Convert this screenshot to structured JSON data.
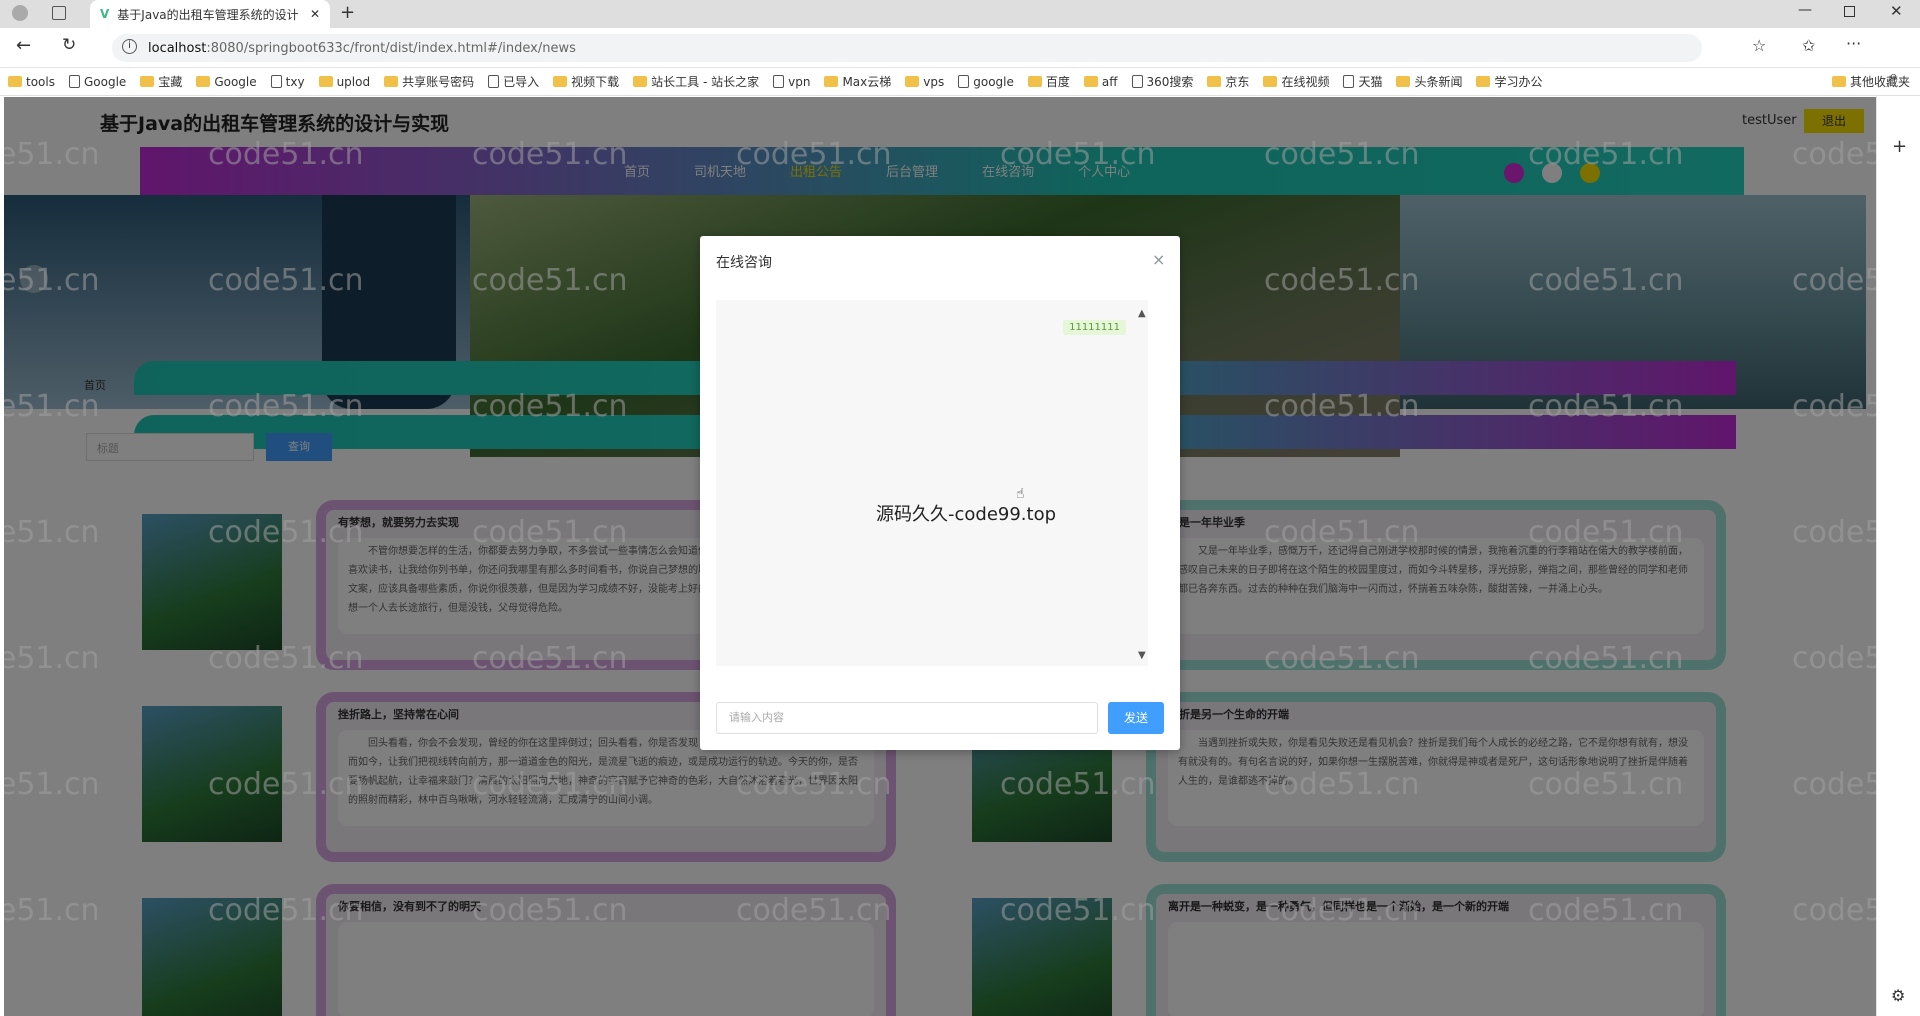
{
  "browser": {
    "tab_title": "基于Java的出租车管理系统的设计",
    "url_host": "localhost",
    "url_rest": ":8080/springboot633c/front/dist/index.html#/index/news",
    "bookmarks": [
      "tools",
      "Google",
      "宝藏",
      "Google",
      "txy",
      "uplod",
      "共享账号密码",
      "已导入",
      "视频下载",
      "站长工具 - 站长之家",
      "vpn",
      "Max云梯",
      "vps",
      "google",
      "百度",
      "aff",
      "360搜索",
      "京东",
      "在线视频",
      "天猫",
      "头条新闻",
      "学习办公"
    ],
    "other_bookmarks": "其他收藏夹"
  },
  "site": {
    "title": "基于Java的出租车管理系统的设计与实现",
    "user": "testUser",
    "logout": "退出",
    "nav": [
      "首页",
      "司机天地",
      "出租公告",
      "后台管理",
      "在线咨询",
      "个人中心"
    ],
    "breadcrumb_home": "首页",
    "search_placeholder": "标题",
    "search_button": "查询",
    "news": [
      {
        "title": "有梦想，就要努力去实现",
        "text": "不管你想要怎样的生活，你都要去努力争取，不多尝试一些事情怎么会知道你适合什么、不适合什么呢？你说你喜欢读书，让我给你列书单，你还问我哪里有那么多时间看书，你说自己梦想的职业是广告文案，问我如何成为一个文案，应该具备哪些素质，你说你很羡慕，但是因为学习成绩不好，没能考上好的学校……起不了床，你说你一直梦想一个人去长途旅行，但是没钱，父母觉得危险。"
      },
      {
        "title": "又是一年毕业季",
        "text": "又是一年毕业季，感慨万千，还记得自己刚进学校那时候的情景，我拖着沉重的行李箱站在偌大的教学楼前面，感叹自己未来的日子即将在这个陌生的校园里度过，而如今斗转星移，浮光掠影，弹指之间，那些曾经的同学和老师都已各奔东西。过去的种种在我们脑海中一闪而过，怀揣着五味杂陈，酸甜苦辣，一并涌上心头。"
      },
      {
        "title": "挫折路上，坚持常在心间",
        "text": "回头看看，你会不会发现，曾经的你在这里摔倒过；回头看看，你是否发现，一次次地重复着，却从没有超过。而如今，让我们把视线转向前方，那一道道金色的阳光，是流星飞逝的痕迹，或是成功运行的轨迹。今天的你，是否要扬帆起航，让幸福来敲门？清晨的太阳照向大地，神奇的宇宙赋予它神奇的色彩，大自然沐浴着春光，世界因太阳的照射而精彩，林中百鸟啾啾，河水轻轻流淌，汇成清宁的山间小调。"
      },
      {
        "title": "挫折是另一个生命的开端",
        "text": "当遇到挫折或失败，你是看见失败还是看见机会？挫折是我们每个人成长的必经之路，它不是你想有就有，想没有就没有的。有句名言说的好，如果你想一生摆脱苦难，你就得是神或者是死尸，这句话形象地说明了挫折是伴随着人生的，是谁都逃不掉的。"
      },
      {
        "title": "你要相信，没有到不了的明天",
        "text": ""
      },
      {
        "title": "离开是一种蜕变，是一种勇气，但同样也是一个渐始，是一个新的开端",
        "text": ""
      }
    ]
  },
  "modal": {
    "title": "在线咨询",
    "close": "×",
    "message": "11111111",
    "brand": "源码久久-code99.top",
    "input_placeholder": "请输入内容",
    "send": "发送"
  },
  "watermark": "code51.cn"
}
